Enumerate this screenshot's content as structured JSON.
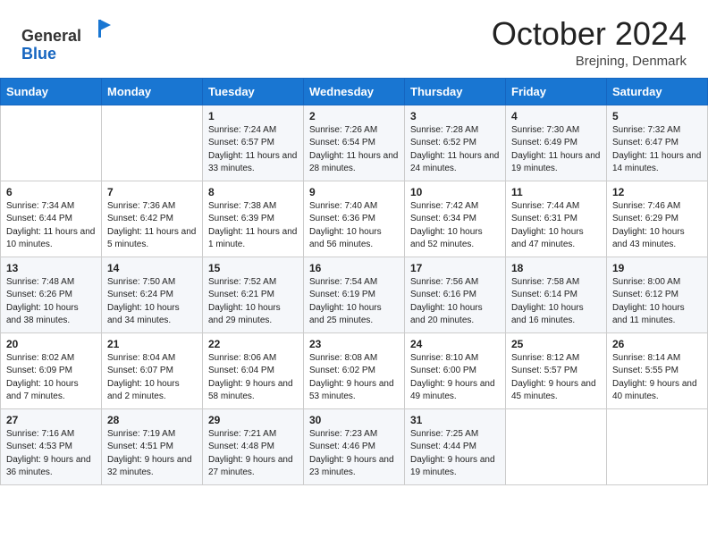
{
  "header": {
    "logo_general": "General",
    "logo_blue": "Blue",
    "title": "October 2024",
    "subtitle": "Brejning, Denmark"
  },
  "weekdays": [
    "Sunday",
    "Monday",
    "Tuesday",
    "Wednesday",
    "Thursday",
    "Friday",
    "Saturday"
  ],
  "rows": [
    [
      {
        "day": "",
        "sunrise": "",
        "sunset": "",
        "daylight": ""
      },
      {
        "day": "",
        "sunrise": "",
        "sunset": "",
        "daylight": ""
      },
      {
        "day": "1",
        "sunrise": "Sunrise: 7:24 AM",
        "sunset": "Sunset: 6:57 PM",
        "daylight": "Daylight: 11 hours and 33 minutes."
      },
      {
        "day": "2",
        "sunrise": "Sunrise: 7:26 AM",
        "sunset": "Sunset: 6:54 PM",
        "daylight": "Daylight: 11 hours and 28 minutes."
      },
      {
        "day": "3",
        "sunrise": "Sunrise: 7:28 AM",
        "sunset": "Sunset: 6:52 PM",
        "daylight": "Daylight: 11 hours and 24 minutes."
      },
      {
        "day": "4",
        "sunrise": "Sunrise: 7:30 AM",
        "sunset": "Sunset: 6:49 PM",
        "daylight": "Daylight: 11 hours and 19 minutes."
      },
      {
        "day": "5",
        "sunrise": "Sunrise: 7:32 AM",
        "sunset": "Sunset: 6:47 PM",
        "daylight": "Daylight: 11 hours and 14 minutes."
      }
    ],
    [
      {
        "day": "6",
        "sunrise": "Sunrise: 7:34 AM",
        "sunset": "Sunset: 6:44 PM",
        "daylight": "Daylight: 11 hours and 10 minutes."
      },
      {
        "day": "7",
        "sunrise": "Sunrise: 7:36 AM",
        "sunset": "Sunset: 6:42 PM",
        "daylight": "Daylight: 11 hours and 5 minutes."
      },
      {
        "day": "8",
        "sunrise": "Sunrise: 7:38 AM",
        "sunset": "Sunset: 6:39 PM",
        "daylight": "Daylight: 11 hours and 1 minute."
      },
      {
        "day": "9",
        "sunrise": "Sunrise: 7:40 AM",
        "sunset": "Sunset: 6:36 PM",
        "daylight": "Daylight: 10 hours and 56 minutes."
      },
      {
        "day": "10",
        "sunrise": "Sunrise: 7:42 AM",
        "sunset": "Sunset: 6:34 PM",
        "daylight": "Daylight: 10 hours and 52 minutes."
      },
      {
        "day": "11",
        "sunrise": "Sunrise: 7:44 AM",
        "sunset": "Sunset: 6:31 PM",
        "daylight": "Daylight: 10 hours and 47 minutes."
      },
      {
        "day": "12",
        "sunrise": "Sunrise: 7:46 AM",
        "sunset": "Sunset: 6:29 PM",
        "daylight": "Daylight: 10 hours and 43 minutes."
      }
    ],
    [
      {
        "day": "13",
        "sunrise": "Sunrise: 7:48 AM",
        "sunset": "Sunset: 6:26 PM",
        "daylight": "Daylight: 10 hours and 38 minutes."
      },
      {
        "day": "14",
        "sunrise": "Sunrise: 7:50 AM",
        "sunset": "Sunset: 6:24 PM",
        "daylight": "Daylight: 10 hours and 34 minutes."
      },
      {
        "day": "15",
        "sunrise": "Sunrise: 7:52 AM",
        "sunset": "Sunset: 6:21 PM",
        "daylight": "Daylight: 10 hours and 29 minutes."
      },
      {
        "day": "16",
        "sunrise": "Sunrise: 7:54 AM",
        "sunset": "Sunset: 6:19 PM",
        "daylight": "Daylight: 10 hours and 25 minutes."
      },
      {
        "day": "17",
        "sunrise": "Sunrise: 7:56 AM",
        "sunset": "Sunset: 6:16 PM",
        "daylight": "Daylight: 10 hours and 20 minutes."
      },
      {
        "day": "18",
        "sunrise": "Sunrise: 7:58 AM",
        "sunset": "Sunset: 6:14 PM",
        "daylight": "Daylight: 10 hours and 16 minutes."
      },
      {
        "day": "19",
        "sunrise": "Sunrise: 8:00 AM",
        "sunset": "Sunset: 6:12 PM",
        "daylight": "Daylight: 10 hours and 11 minutes."
      }
    ],
    [
      {
        "day": "20",
        "sunrise": "Sunrise: 8:02 AM",
        "sunset": "Sunset: 6:09 PM",
        "daylight": "Daylight: 10 hours and 7 minutes."
      },
      {
        "day": "21",
        "sunrise": "Sunrise: 8:04 AM",
        "sunset": "Sunset: 6:07 PM",
        "daylight": "Daylight: 10 hours and 2 minutes."
      },
      {
        "day": "22",
        "sunrise": "Sunrise: 8:06 AM",
        "sunset": "Sunset: 6:04 PM",
        "daylight": "Daylight: 9 hours and 58 minutes."
      },
      {
        "day": "23",
        "sunrise": "Sunrise: 8:08 AM",
        "sunset": "Sunset: 6:02 PM",
        "daylight": "Daylight: 9 hours and 53 minutes."
      },
      {
        "day": "24",
        "sunrise": "Sunrise: 8:10 AM",
        "sunset": "Sunset: 6:00 PM",
        "daylight": "Daylight: 9 hours and 49 minutes."
      },
      {
        "day": "25",
        "sunrise": "Sunrise: 8:12 AM",
        "sunset": "Sunset: 5:57 PM",
        "daylight": "Daylight: 9 hours and 45 minutes."
      },
      {
        "day": "26",
        "sunrise": "Sunrise: 8:14 AM",
        "sunset": "Sunset: 5:55 PM",
        "daylight": "Daylight: 9 hours and 40 minutes."
      }
    ],
    [
      {
        "day": "27",
        "sunrise": "Sunrise: 7:16 AM",
        "sunset": "Sunset: 4:53 PM",
        "daylight": "Daylight: 9 hours and 36 minutes."
      },
      {
        "day": "28",
        "sunrise": "Sunrise: 7:19 AM",
        "sunset": "Sunset: 4:51 PM",
        "daylight": "Daylight: 9 hours and 32 minutes."
      },
      {
        "day": "29",
        "sunrise": "Sunrise: 7:21 AM",
        "sunset": "Sunset: 4:48 PM",
        "daylight": "Daylight: 9 hours and 27 minutes."
      },
      {
        "day": "30",
        "sunrise": "Sunrise: 7:23 AM",
        "sunset": "Sunset: 4:46 PM",
        "daylight": "Daylight: 9 hours and 23 minutes."
      },
      {
        "day": "31",
        "sunrise": "Sunrise: 7:25 AM",
        "sunset": "Sunset: 4:44 PM",
        "daylight": "Daylight: 9 hours and 19 minutes."
      },
      {
        "day": "",
        "sunrise": "",
        "sunset": "",
        "daylight": ""
      },
      {
        "day": "",
        "sunrise": "",
        "sunset": "",
        "daylight": ""
      }
    ]
  ]
}
